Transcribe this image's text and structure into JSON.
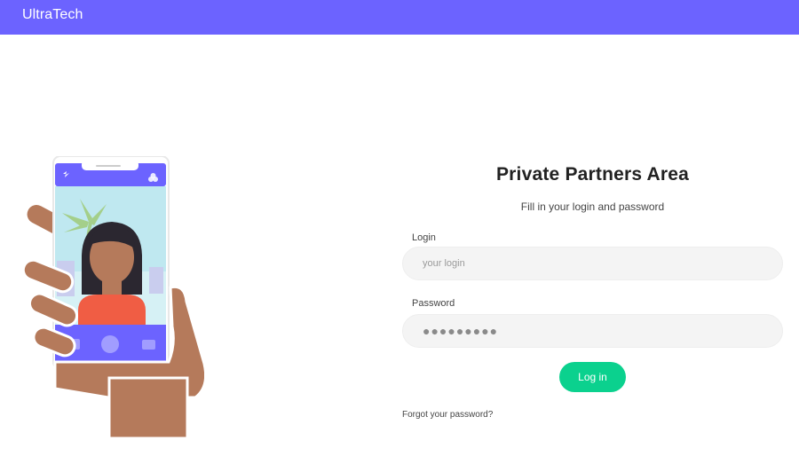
{
  "header": {
    "brand": "UltraTech"
  },
  "form": {
    "title": "Private Partners Area",
    "subtitle": "Fill in your login and password",
    "login_label": "Login",
    "login_placeholder": "your login",
    "password_label": "Password",
    "password_value": "●●●●●●●●●",
    "submit_label": "Log in",
    "forgot_label": "Forgot your password?"
  },
  "colors": {
    "header_bg": "#6c63ff",
    "button_bg": "#0bd18e",
    "input_bg": "#f4f4f4"
  },
  "illustration": {
    "description_icons": [
      "lightning-icon",
      "settings-icon",
      "gallery-icon",
      "shutter-icon",
      "camera-icon"
    ]
  }
}
